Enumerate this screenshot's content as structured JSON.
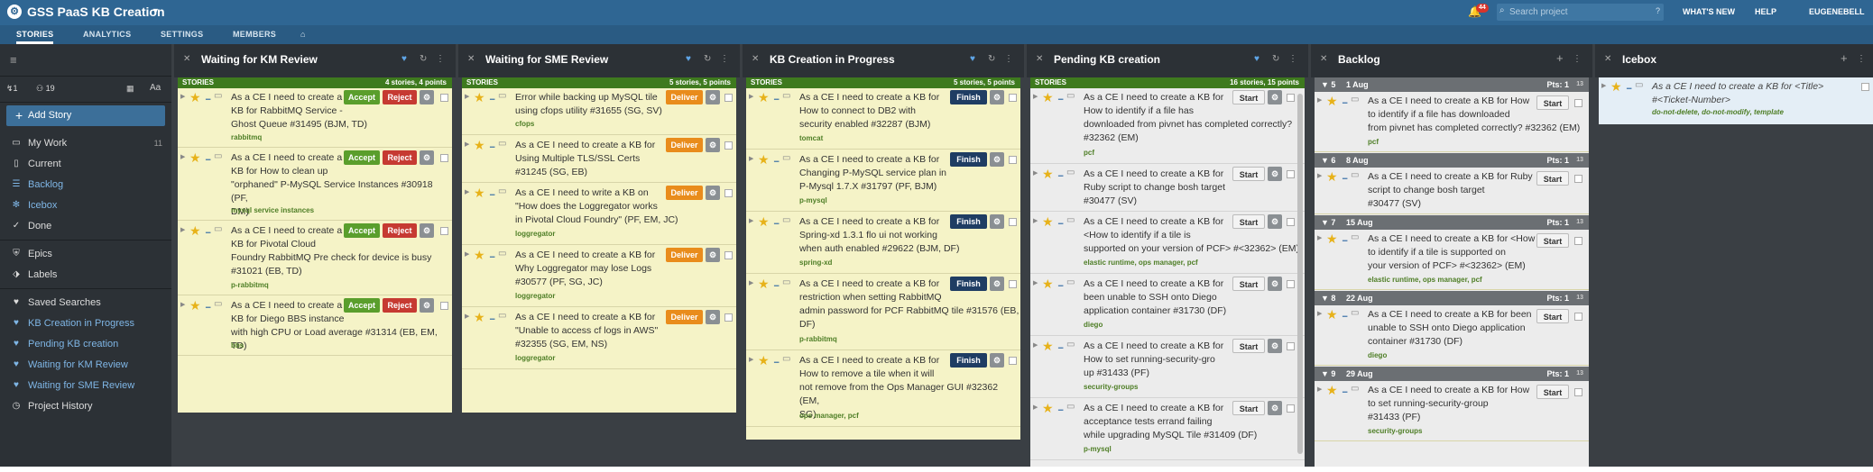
{
  "topbar": {
    "project": "GSS PaaS KB Creation",
    "notif_count": "44",
    "search_placeholder": "Search project",
    "menu": [
      "WHAT'S NEW",
      "HELP",
      "EUGENEBELL"
    ]
  },
  "tabs": [
    "STORIES",
    "ANALYTICS",
    "SETTINGS",
    "MEMBERS"
  ],
  "sidebar": {
    "counts": {
      "iterations": "1",
      "people": "19"
    },
    "add_story": "Add Story",
    "items": [
      {
        "label": "My Work",
        "count": "11"
      },
      {
        "label": "Current",
        "count": ""
      },
      {
        "label": "Backlog",
        "count": ""
      },
      {
        "label": "Icebox",
        "count": ""
      },
      {
        "label": "Done",
        "count": ""
      },
      {
        "label": "Epics",
        "count": ""
      },
      {
        "label": "Labels",
        "count": ""
      },
      {
        "label": "Saved Searches",
        "count": ""
      },
      {
        "label": "KB Creation in Progress",
        "count": ""
      },
      {
        "label": "Pending KB creation",
        "count": ""
      },
      {
        "label": "Waiting for KM Review",
        "count": ""
      },
      {
        "label": "Waiting for SME Review",
        "count": ""
      },
      {
        "label": "Project History",
        "count": ""
      }
    ]
  },
  "panels": [
    {
      "title": "Waiting for KM Review",
      "strip_label": "STORIES",
      "strip_count": "4 stories, 4 points",
      "stories": [
        {
          "lines": [
            "As a CE I need to create a",
            "KB for RabbitMQ Service -",
            "Ghost Queue #31495 (BJM, TD)"
          ],
          "tags": "rabbitmq",
          "buttons": [
            "Accept",
            "Reject"
          ]
        },
        {
          "lines": [
            "As a CE I need to create a",
            "KB for How to clean up",
            "\"orphaned\" P-MySQL Service Instances #30918 (PF,",
            "DM)"
          ],
          "tags": "mysql service instances",
          "buttons": [
            "Accept",
            "Reject"
          ]
        },
        {
          "lines": [
            "As a CE I need to create a",
            "KB for Pivotal Cloud",
            "Foundry RabbitMQ Pre check for device is busy",
            "#31021 (EB, TD)"
          ],
          "tags": "p-rabbitmq",
          "buttons": [
            "Accept",
            "Reject"
          ]
        },
        {
          "lines": [
            "As a CE I need to create a",
            "KB for Diego BBS instance",
            "with high CPU or Load average #31314 (EB, EM, TD)"
          ],
          "tags": "bbs",
          "buttons": [
            "Accept",
            "Reject"
          ]
        }
      ]
    },
    {
      "title": "Waiting for SME Review",
      "strip_label": "STORIES",
      "strip_count": "5 stories, 5 points",
      "stories": [
        {
          "lines": [
            "Error while backing up MySQL tile",
            "using cfops utility #31655 (SG, SV)"
          ],
          "tags": "cfops",
          "buttons": [
            "Deliver"
          ]
        },
        {
          "lines": [
            "As a CE I need to create a KB for",
            "Using Multiple TLS/SSL Certs",
            "#31245 (SG, EB)"
          ],
          "tags": "",
          "buttons": [
            "Deliver"
          ]
        },
        {
          "lines": [
            "As a CE I need to write a KB on",
            "\"How does the Loggregator works",
            "in Pivotal Cloud Foundry\" (PF, EM, JC)"
          ],
          "tags": "loggregator",
          "buttons": [
            "Deliver"
          ]
        },
        {
          "lines": [
            "As a CE I need to create a KB for",
            "Why Loggregator may lose Logs",
            "#30577 (PF, SG, JC)"
          ],
          "tags": "loggregator",
          "buttons": [
            "Deliver"
          ]
        },
        {
          "lines": [
            "As a CE I need to create a KB for",
            "\"Unable to access cf logs in AWS\"",
            "#32355 (SG, EM, NS)"
          ],
          "tags": "loggregator",
          "buttons": [
            "Deliver"
          ]
        }
      ]
    },
    {
      "title": "KB Creation in Progress",
      "strip_label": "STORIES",
      "strip_count": "5 stories, 5 points",
      "stories": [
        {
          "lines": [
            "As a CE I need to create a KB for",
            "How to connect to DB2 with",
            "security enabled #32287 (BJM)"
          ],
          "tags": "tomcat",
          "buttons": [
            "Finish"
          ]
        },
        {
          "lines": [
            "As a CE I need to create a KB for",
            "Changing P-MySQL service plan in",
            "P-Mysql 1.7.X #31797 (PF, BJM)"
          ],
          "tags": "p-mysql",
          "buttons": [
            "Finish"
          ]
        },
        {
          "lines": [
            "As a CE I need to create a KB for",
            "Spring-xd 1.3.1 flo ui not working",
            "when auth enabled #29622 (BJM, DF)"
          ],
          "tags": "spring-xd",
          "buttons": [
            "Finish"
          ]
        },
        {
          "lines": [
            "As a CE I need to create a KB for",
            "restriction when setting RabbitMQ",
            "admin password for PCF RabbitMQ tile #31576 (EB,",
            "DF)"
          ],
          "tags": "p-rabbitmq",
          "buttons": [
            "Finish"
          ]
        },
        {
          "lines": [
            "As a CE I need to create a KB for",
            "How to remove a tile when it will",
            "not remove from the Ops Manager GUI #32362 (EM,",
            "SG)"
          ],
          "tags": "ops manager, pcf",
          "buttons": [
            "Finish"
          ]
        }
      ]
    },
    {
      "title": "Pending KB creation",
      "strip_label": "STORIES",
      "strip_count": "16 stories, 15 points",
      "stories": [
        {
          "lines": [
            "As a CE I need to create a KB for",
            "How to identify if a file has",
            "downloaded from pivnet has completed correctly?",
            "#32362 (EM)"
          ],
          "tags": "pcf",
          "buttons": [
            "Start"
          ]
        },
        {
          "lines": [
            "As a CE I need to create a KB for",
            "Ruby script to change bosh target",
            "#30477 (SV)"
          ],
          "tags": "",
          "buttons": [
            "Start"
          ]
        },
        {
          "lines": [
            "As a CE I need to create a KB for",
            "<How to identify if a tile is",
            "supported on your version of PCF> #<32362> (EM)"
          ],
          "tags": "elastic runtime, ops manager, pcf",
          "buttons": [
            "Start"
          ]
        },
        {
          "lines": [
            "As a CE I need to create a KB for",
            "been unable to SSH onto Diego",
            "application container #31730 (DF)"
          ],
          "tags": "diego",
          "buttons": [
            "Start"
          ]
        },
        {
          "lines": [
            "As a CE I need to create a KB for",
            "How to set running-security-gro",
            "up #31433 (PF)"
          ],
          "tags": "security-groups",
          "buttons": [
            "Start"
          ]
        },
        {
          "lines": [
            "As a CE I need to create a KB for",
            "acceptance tests errand failing",
            "while upgrading MySQL Tile #31409 (DF)"
          ],
          "tags": "p-mysql",
          "buttons": [
            "Start"
          ]
        }
      ]
    },
    {
      "title": "Backlog",
      "iterations": [
        {
          "num": "5",
          "date": "1 Aug",
          "pts": "Pts: 1",
          "tag": "13",
          "story": {
            "lines": [
              "As a CE I need to create a KB for How",
              "to identify if a file has downloaded",
              "from pivnet has completed correctly? #32362 (EM)"
            ],
            "tags": "pcf"
          }
        },
        {
          "num": "6",
          "date": "8 Aug",
          "pts": "Pts: 1",
          "tag": "13",
          "story": {
            "lines": [
              "As a CE I need to create a KB for Ruby",
              "script to change bosh target",
              "#30477 (SV)"
            ],
            "tags": ""
          }
        },
        {
          "num": "7",
          "date": "15 Aug",
          "pts": "Pts: 1",
          "tag": "13",
          "story": {
            "lines": [
              "As a CE I need to create a KB for <How",
              "to identify if a tile is supported on",
              "your version of PCF> #<32362> (EM)"
            ],
            "tags": "elastic runtime, ops manager, pcf"
          }
        },
        {
          "num": "8",
          "date": "22 Aug",
          "pts": "Pts: 1",
          "tag": "13",
          "story": {
            "lines": [
              "As a CE I need to create a KB for been",
              "unable to SSH onto Diego application",
              "container #31730 (DF)"
            ],
            "tags": "diego"
          }
        },
        {
          "num": "9",
          "date": "29 Aug",
          "pts": "Pts: 1",
          "tag": "13",
          "story": {
            "lines": [
              "As a CE I need to create a KB for How",
              "to set running-security-group",
              "#31433 (PF)"
            ],
            "tags": "security-groups"
          }
        }
      ],
      "start_label": "Start"
    },
    {
      "title": "Icebox",
      "story": {
        "lines": [
          "As a CE I need to create a KB for <Title>",
          "#<Ticket-Number>"
        ],
        "tags": "do-not-delete, do-not-modify, template"
      }
    }
  ]
}
